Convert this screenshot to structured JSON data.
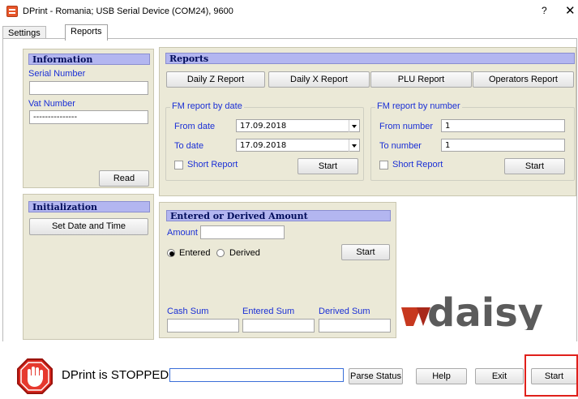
{
  "window": {
    "title": "DPrint - Romania; USB Serial Device (COM24), 9600",
    "help_label": "?",
    "close_label": "✕"
  },
  "tabs": [
    {
      "label": "Settings",
      "active": false
    },
    {
      "label": "Reports",
      "active": true
    }
  ],
  "information": {
    "header": "Information",
    "serial_label": "Serial Number",
    "serial_value": "",
    "vat_label": "Vat Number",
    "vat_value": "---------------",
    "read_label": "Read"
  },
  "initialization": {
    "header": "Initialization",
    "set_date_label": "Set Date and Time"
  },
  "reports": {
    "header": "Reports",
    "buttons": [
      "Daily Z Report",
      "Daily X Report",
      "PLU Report",
      "Operators Report"
    ],
    "by_date": {
      "legend": "FM report by date",
      "from_label": "From date",
      "from_value": "17.09.2018",
      "to_label": "To date",
      "to_value": "17.09.2018",
      "short_label": "Short Report",
      "start_label": "Start"
    },
    "by_number": {
      "legend": "FM report by number",
      "from_label": "From number",
      "from_value": "1",
      "to_label": "To number",
      "to_value": "1",
      "short_label": "Short Report",
      "start_label": "Start"
    }
  },
  "amount": {
    "header": "Entered or Derived Amount",
    "amount_label": "Amount",
    "amount_value": "",
    "entered_label": "Entered",
    "derived_label": "Derived",
    "selected": "Entered",
    "start_label": "Start",
    "cash_sum_label": "Cash Sum",
    "entered_sum_label": "Entered Sum",
    "derived_sum_label": "Derived Sum"
  },
  "logo": {
    "text": "daisy",
    "color": "#5b5b5b",
    "accent": "#c7381f"
  },
  "footer": {
    "status": "DPrint is STOPPED",
    "status_value": "",
    "parse_status_label": "Parse Status",
    "help_label": "Help",
    "exit_label": "Exit",
    "start_label": "Start"
  },
  "colors": {
    "panel": "#ebe9d7",
    "header": "#b3b6f0",
    "label_blue": "#1a2fd6",
    "highlight": "#e0201b"
  }
}
